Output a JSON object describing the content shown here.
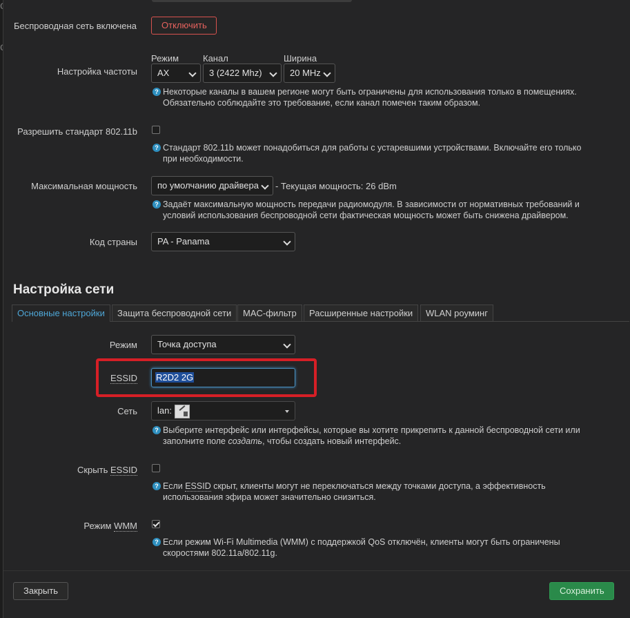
{
  "wireless_enabled": {
    "label": "Беспроводная сеть включена",
    "button": "Отключить"
  },
  "frequency": {
    "label": "Настройка частоты",
    "mode_label": "Режим",
    "mode_value": "AX",
    "channel_label": "Канал",
    "channel_value": "3 (2422 Mhz)",
    "width_label": "Ширина",
    "width_value": "20 MHz",
    "help_line1": "Некоторые каналы в вашем регионе могут быть ограничены для использования только в помещениях.",
    "help_line2": "Обязательно соблюдайте это требование, если канал помечен таким образом."
  },
  "allow_legacy": {
    "label": "Разрешить стандарт 802.11b",
    "checked": false,
    "help_line1": "Стандарт 802.11b может понадобиться для работы с устаревшими устройствами. Включайте его только",
    "help_line2": "при необходимости."
  },
  "tx_power": {
    "label": "Максимальная мощность",
    "value": "по умолчанию драйвера",
    "current": "- Текущая мощность: 26 dBm",
    "help_line1": "Задаёт максимальную мощность передачи радиомодуля. В зависимости от нормативных требований и",
    "help_line2": "условий использования беспроводной сети фактическая мощность может быть снижена драйвером."
  },
  "country": {
    "label": "Код страны",
    "value": "PA - Panama"
  },
  "section_title": "Настройка сети",
  "tabs": [
    {
      "label": "Основные настройки",
      "active": true
    },
    {
      "label": "Защита беспроводной сети",
      "active": false
    },
    {
      "label": "MAC-фильтр",
      "active": false
    },
    {
      "label": "Расширенные настройки",
      "active": false
    },
    {
      "label": "WLAN роуминг",
      "active": false
    }
  ],
  "mode": {
    "label": "Режим",
    "value": "Точка доступа"
  },
  "essid": {
    "label": "ESSID",
    "value": "R2D2 2G"
  },
  "network": {
    "label": "Сеть",
    "value": "lan:",
    "help_line1": "Выберите интерфейс или интерфейсы, которые вы хотите прикрепить к данной беспроводной сети или",
    "help_line2_a": "заполните поле ",
    "help_line2_em": "создать",
    "help_line2_b": ", чтобы создать новый интерфейс."
  },
  "hide_essid": {
    "label_prefix": "Скрыть ",
    "label_abbr": "ESSID",
    "checked": false,
    "help_a": "Если ",
    "help_abbr": "ESSID",
    "help_b": " скрыт, клиенты могут не переключаться между точками доступа, а эффективность",
    "help_line2": "использования эфира может значительно снизиться."
  },
  "wmm": {
    "label_prefix": "Режим ",
    "label_abbr": "WMM",
    "checked": true,
    "help_line1": "Если режим Wi-Fi Multimedia (WMM) с поддержкой QoS отключён, клиенты могут быть ограничены",
    "help_line2": "скоростями 802.11a/802.11g."
  },
  "footer": {
    "close": "Закрыть",
    "save": "Сохранить"
  },
  "colors": {
    "accent": "#4ea6d6",
    "danger": "#d9534f",
    "save": "#2a8a4a",
    "highlight": "#d61f26"
  }
}
